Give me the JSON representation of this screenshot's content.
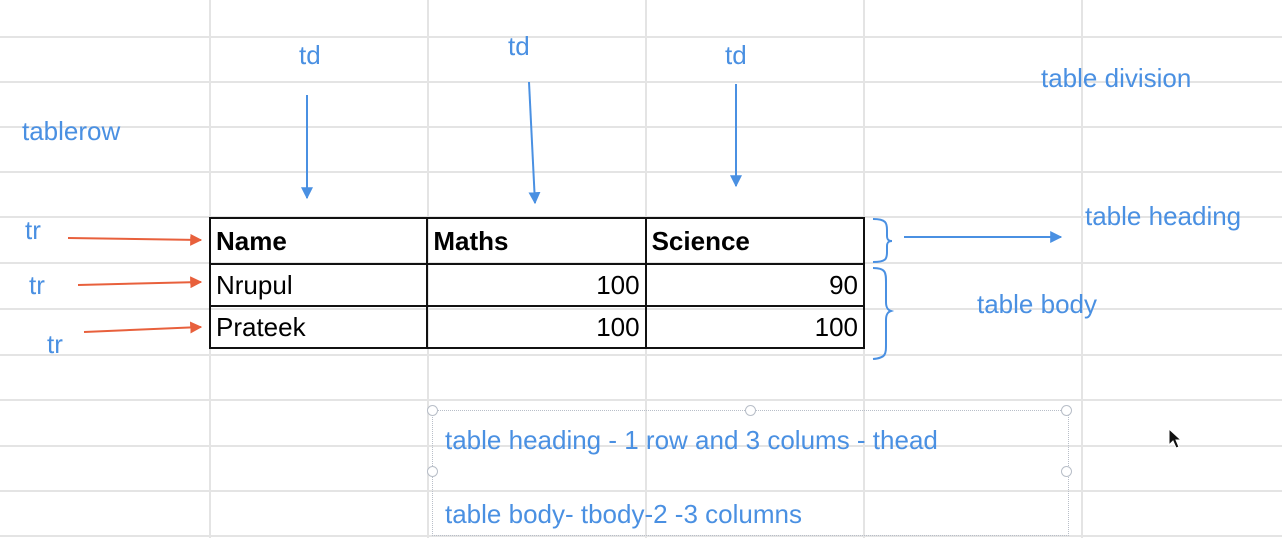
{
  "annotations": {
    "td_1": "td",
    "td_2": "td",
    "td_3": "td",
    "table_division": "table division",
    "tablerow": "tablerow",
    "tr_1": "tr",
    "tr_2": "tr",
    "tr_3": "tr",
    "table_heading": "table heading",
    "table_body": "table body"
  },
  "table": {
    "header": [
      "Name",
      "Maths",
      "Science"
    ],
    "rows": [
      [
        "Nrupul",
        "100",
        "90"
      ],
      [
        "Prateek",
        "100",
        "100"
      ]
    ]
  },
  "textbox": {
    "line1": "table heading - 1 row and 3 colums - thead",
    "line2": "table body- tbody-2 -3 columns"
  },
  "colors": {
    "annotation_blue": "#4a90e2",
    "arrow_orange": "#e8603c",
    "grid": "#e4e4e4"
  },
  "icons": [
    "arrow-down-icon",
    "arrow-right-icon",
    "curly-brace-icon",
    "mouse-pointer-icon"
  ]
}
